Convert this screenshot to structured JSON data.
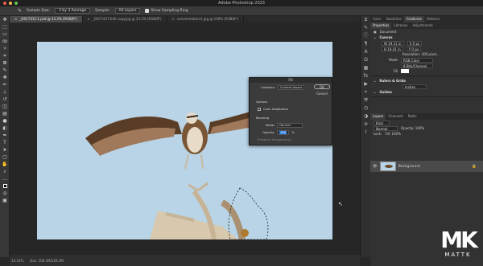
{
  "window": {
    "title": "Adobe Photoshop 2023"
  },
  "options_bar": {
    "sample_size_label": "Sample Size:",
    "sample_size_value": "3 by 3 Average",
    "sample_label": "Sample:",
    "sample_value": "All Layers",
    "show_ring": "Show Sampling Ring"
  },
  "doc_tabs": [
    {
      "label": "_DSC7415-1.psd @ 33.3% (RGB/8*)",
      "active": true
    },
    {
      "label": "_DSC7437-Edit copy.jpg @ 33.3% (RGB/8*)",
      "active": false
    },
    {
      "label": "commentators1.jpg @ 100% (RGB/8*)",
      "active": false
    }
  ],
  "status": {
    "zoom": "33.33%",
    "doc": "Doc: 108.3M/128.3M"
  },
  "fill_dialog": {
    "title": "Fill",
    "contents_label": "Contents:",
    "contents_value": "Content-Aware",
    "options_label": "Options",
    "color_adapt": "Color Adaptation",
    "blending_label": "Blending",
    "mode_label": "Mode:",
    "mode_value": "Normal",
    "opacity_label": "Opacity:",
    "opacity_value": "100",
    "opacity_unit": "%",
    "preserve": "Preserve Transparency",
    "ok": "OK",
    "cancel": "Cancel"
  },
  "right_panel": {
    "top_tabs": [
      "Color",
      "Swatches",
      "Gradients",
      "Patterns"
    ],
    "prop_tabs": [
      "Properties",
      "Libraries",
      "Adjustments"
    ],
    "document_label": "Document",
    "canvas_header": "Canvas",
    "w_value": "W  29.11 in",
    "h_value": "H  19.41 in",
    "x_value": "X  0 px",
    "y_value": "Y  0 px",
    "resolution": "Resolution: 300 pixel...",
    "mode_label": "Mode",
    "mode_value": "RGB Color",
    "bits_value": "8 Bits/Channel",
    "fill_label": "Fill",
    "rulers_header": "Rulers & Grids",
    "rulers_unit": "Inches",
    "guides_header": "Guides",
    "layer_tabs": [
      "Layers",
      "Channels",
      "Paths"
    ],
    "kind_label": "Kind",
    "blend_mode": "Normal",
    "opacity": "Opacity: 100%",
    "lock": "Lock:",
    "fill": "Fill: 100%",
    "layer_name": "Background"
  },
  "watermark": {
    "mk": "MK",
    "text": "MATTK"
  }
}
